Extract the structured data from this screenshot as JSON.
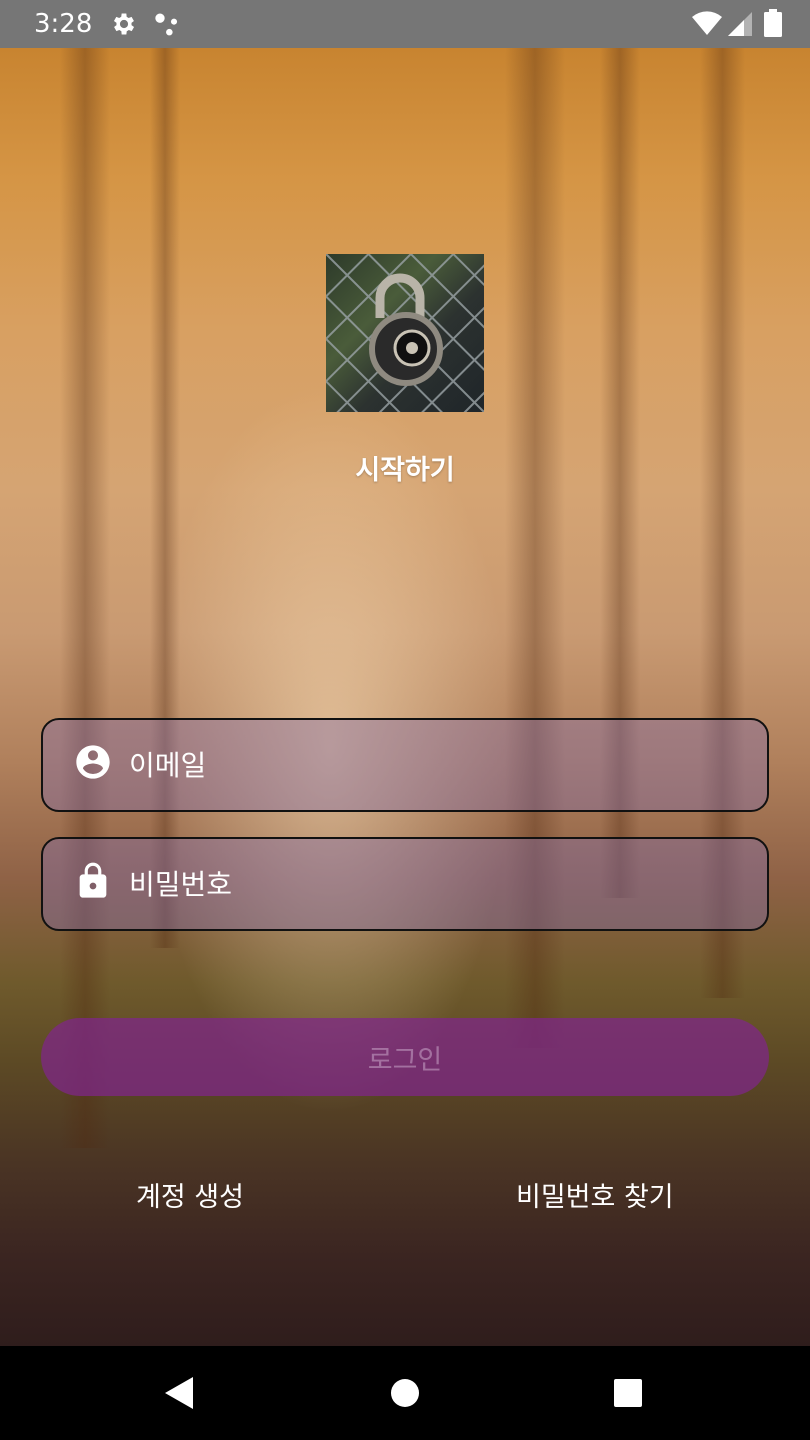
{
  "status_bar": {
    "time": "3:28",
    "icons": [
      "gear-icon",
      "assistant-dots-icon",
      "wifi-icon",
      "cell-signal-icon",
      "battery-icon"
    ]
  },
  "logo": {
    "icon": "combination-padlock-on-chain-link-fence-image"
  },
  "title": "시작하기",
  "form": {
    "email": {
      "icon": "account-circle-icon",
      "placeholder": "이메일",
      "value": ""
    },
    "password": {
      "icon": "lock-icon",
      "placeholder": "비밀번호",
      "value": ""
    },
    "login_label": "로그인"
  },
  "links": {
    "create_account": "계정 생성",
    "find_password": "비밀번호 찾기"
  },
  "nav_bar": {
    "icons": [
      "back-icon",
      "home-icon",
      "recents-icon"
    ]
  },
  "colors": {
    "status_bar": "#767676",
    "field_border": "#111111",
    "login_button": "#80268A",
    "text": "#FFFFFF"
  }
}
